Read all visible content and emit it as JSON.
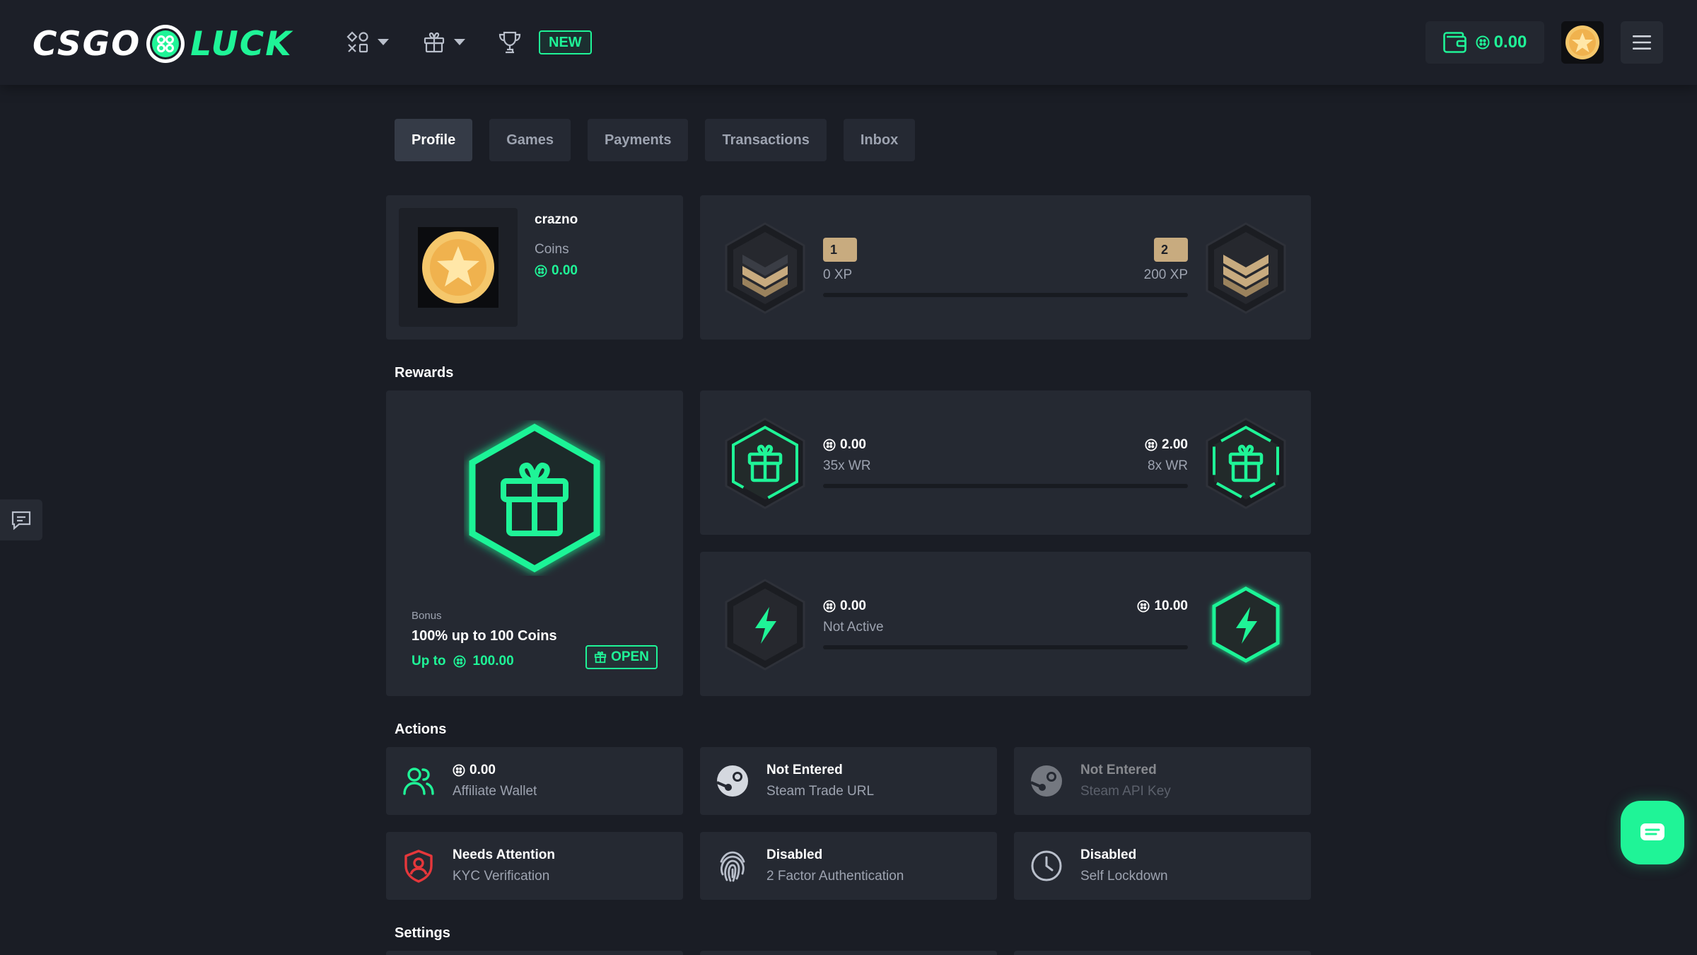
{
  "header": {
    "logo": {
      "left_text": "CSGO",
      "right_text": "LUCK"
    },
    "new_badge": "NEW",
    "wallet_balance": "0.00"
  },
  "tabs": [
    {
      "label": "Profile",
      "active": true
    },
    {
      "label": "Games"
    },
    {
      "label": "Payments"
    },
    {
      "label": "Transactions"
    },
    {
      "label": "Inbox"
    }
  ],
  "profile": {
    "username": "crazno",
    "coins_label": "Coins",
    "coins_value": "0.00"
  },
  "level": {
    "current_level": "1",
    "current_xp": "0 XP",
    "next_level": "2",
    "next_xp": "200 XP",
    "progress": 0
  },
  "rewards": {
    "title": "Rewards",
    "bonus": {
      "label": "Bonus",
      "title": "100% up to 100 Coins",
      "up_to_label": "Up to",
      "up_to_value": "100.00",
      "open_label": "OPEN"
    },
    "wager": {
      "left_value": "0.00",
      "left_sub": "35x WR",
      "right_value": "2.00",
      "right_sub": "8x WR",
      "progress": 0
    },
    "boost": {
      "left_value": "0.00",
      "left_sub": "Not Active",
      "right_value": "10.00",
      "progress": 0
    }
  },
  "actions": {
    "title": "Actions",
    "items": [
      {
        "title": "0.00",
        "sub": "Affiliate Wallet",
        "icon": "users-icon"
      },
      {
        "title": "Not Entered",
        "sub": "Steam Trade URL",
        "icon": "steam-icon"
      },
      {
        "title": "Not Entered",
        "sub": "Steam API Key",
        "icon": "steam-icon"
      },
      {
        "title": "Needs Attention",
        "sub": "KYC Verification",
        "icon": "shield-user-icon"
      },
      {
        "title": "Disabled",
        "sub": "2 Factor Authentication",
        "icon": "fingerprint-icon"
      },
      {
        "title": "Disabled",
        "sub": "Self Lockdown",
        "icon": "clock-icon"
      }
    ]
  },
  "settings": {
    "title": "Settings"
  },
  "colors": {
    "accent": "#1ff497",
    "background": "#1a1d25",
    "card": "#252932",
    "danger": "#e5373b",
    "level_badge": "#c8ab7f"
  }
}
